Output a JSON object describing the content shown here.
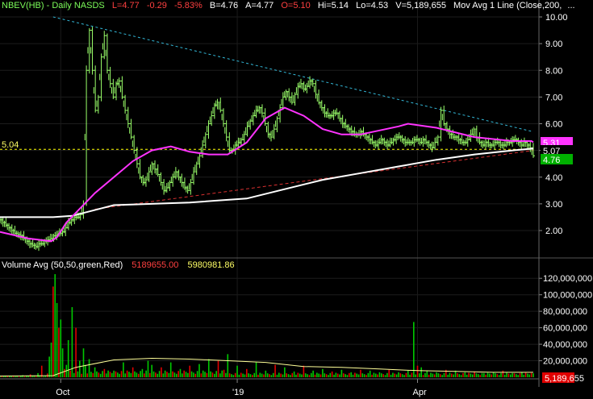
{
  "header": {
    "symbol": "NBEV(HB) - Daily  NASDS",
    "last": "L=4.77",
    "change": "-0.29",
    "change_pct": "-5.83%",
    "bid": "B=4.76",
    "ask": "A=4.77",
    "open": "O=5.10",
    "high": "Hi=5.14",
    "low": "Lo=4.53",
    "volume": "V=5,189,655",
    "study": "Mov Avg 1 Line (Close,200,",
    "more": "..."
  },
  "volume_header": {
    "label": "Volume Avg (50,50,green,Red)",
    "value1": "5189655.00",
    "value2": "5980981.86"
  },
  "price_axis": {
    "ticks": [
      "10.00",
      "9.00",
      "8.00",
      "7.00",
      "6.00",
      "5.00",
      "4.00",
      "3.00",
      "2.00"
    ],
    "tick_values": [
      10,
      9,
      8,
      7,
      6,
      5,
      4,
      3,
      2
    ],
    "ylim": [
      1.0,
      10.3
    ]
  },
  "volume_axis": {
    "ticks": [
      "120,000,000",
      "100,000,000",
      "80,000,000",
      "60,000,000",
      "40,000,000",
      "20,000,000"
    ],
    "tick_values": [
      120000000,
      100000000,
      80000000,
      60000000,
      40000000,
      20000000
    ],
    "ylim": [
      0,
      130000000
    ]
  },
  "x_axis": {
    "labels": [
      "Oct",
      "'19",
      "Apr"
    ],
    "label_index": [
      32,
      125,
      220
    ]
  },
  "value_tags": {
    "mavg": "5.31",
    "sma200": "5.07",
    "last": "4.76",
    "hline_label": "5.04",
    "volume_last": "5,189,655"
  },
  "colors": {
    "background": "#000000",
    "up": "#00c800",
    "down": "#e00000",
    "price": "#9aff6a",
    "mavg": "#ff33ff",
    "sma200": "#ffffff",
    "volume_avg": "#ffff99",
    "resistance": "#33b8d8",
    "support": "#d83030",
    "hline": "#ffff00"
  },
  "chart_data": {
    "type": "line",
    "series": [
      {
        "key": "close",
        "values": [
          2.4,
          2.3,
          2.2,
          2.1,
          2.0,
          1.9,
          1.85,
          1.8,
          1.7,
          1.6,
          1.5,
          1.45,
          1.4,
          1.5,
          1.5,
          1.6,
          1.65,
          1.7,
          1.8,
          1.85,
          1.9,
          1.95,
          2.1,
          2.3,
          2.4,
          2.5,
          2.5,
          2.6,
          3.0,
          8.0,
          9.5,
          8.0,
          6.5,
          7.0,
          8.5,
          9.3,
          8.0,
          7.5,
          7.0,
          7.5,
          7.6,
          7.0,
          6.5,
          6.0,
          5.5,
          5.0,
          4.5,
          4.0,
          3.8,
          3.9,
          4.2,
          4.5,
          4.3,
          4.1,
          3.8,
          3.5,
          3.6,
          3.8,
          4.0,
          4.2,
          4.0,
          3.8,
          3.6,
          3.5,
          3.8,
          4.2,
          4.5,
          4.8,
          5.2,
          5.6,
          6.0,
          6.3,
          6.7,
          6.8,
          6.5,
          6.0,
          5.5,
          5.0,
          5.0,
          5.2,
          5.3,
          5.4,
          5.6,
          5.9,
          6.1,
          6.3,
          6.5,
          6.6,
          6.4,
          6.0,
          5.6,
          5.5,
          5.8,
          6.2,
          6.6,
          7.0,
          7.2,
          7.0,
          6.8,
          7.1,
          7.4,
          7.5,
          7.3,
          7.4,
          7.6,
          7.5,
          7.1,
          6.8,
          6.6,
          6.4,
          6.3,
          6.3,
          6.4,
          6.4,
          6.2,
          6.0,
          5.9,
          5.8,
          5.7,
          5.6,
          5.6,
          5.7,
          5.6,
          5.5,
          5.4,
          5.3,
          5.2,
          5.3,
          5.4,
          5.3,
          5.2,
          5.3,
          5.4,
          5.5,
          5.5,
          5.4,
          5.3,
          5.3,
          5.3,
          5.4,
          5.4,
          5.3,
          5.4,
          5.3,
          5.2,
          5.1,
          5.3,
          5.5,
          6.5,
          6.0,
          5.8,
          5.6,
          5.5,
          5.5,
          5.4,
          5.3,
          5.3,
          5.4,
          5.6,
          5.8,
          5.5,
          5.3,
          5.2,
          5.3,
          5.2,
          5.2,
          5.3,
          5.3,
          5.2,
          5.2,
          5.3,
          5.3,
          5.4,
          5.4,
          5.3,
          5.2,
          5.3,
          5.2,
          5.1,
          4.8
        ],
        "values_are_x_index_from_0": true
      },
      {
        "key": "mavg",
        "name": "Mov Avg 1 Line",
        "x": [
          0,
          15,
          27,
          30,
          35,
          50,
          70,
          80,
          90,
          100,
          110,
          120,
          130,
          140,
          150,
          160,
          170,
          180,
          190,
          210,
          215,
          230,
          250,
          270,
          280,
          281
        ],
        "values": [
          1.95,
          1.7,
          1.6,
          1.75,
          2.3,
          3.4,
          4.6,
          5.0,
          5.15,
          4.95,
          4.85,
          4.85,
          5.3,
          6.2,
          6.6,
          6.3,
          5.8,
          5.6,
          5.6,
          5.9,
          6.0,
          5.85,
          5.5,
          5.35,
          5.35,
          5.31
        ]
      },
      {
        "key": "sma200",
        "x": [
          0,
          28,
          38,
          60,
          80,
          100,
          130,
          150,
          170,
          190,
          210,
          230,
          250,
          270,
          281
        ],
        "values": [
          2.5,
          2.5,
          2.55,
          2.95,
          3.0,
          3.05,
          3.2,
          3.55,
          3.9,
          4.15,
          4.4,
          4.65,
          4.85,
          5.0,
          5.07
        ]
      },
      {
        "key": "volume_avg",
        "x": [
          0,
          28,
          40,
          60,
          80,
          100,
          120,
          140,
          160,
          180,
          200,
          220,
          240,
          260,
          281
        ],
        "values": [
          1500000,
          2000000,
          12000000,
          21000000,
          23000000,
          22000000,
          20000000,
          18000000,
          13000000,
          12000000,
          10000000,
          8000000,
          7000000,
          6000000,
          5980981.86
        ]
      },
      {
        "key": "resistance",
        "x": [
          28,
          281
        ],
        "values": [
          10.0,
          5.7
        ]
      },
      {
        "key": "support",
        "x": [
          50,
          281
        ],
        "values": [
          2.8,
          5.0
        ]
      },
      {
        "key": "hline",
        "x": [
          0,
          281
        ],
        "values": [
          5.04,
          5.04
        ]
      }
    ],
    "volume_spikes": {
      "x": [
        3,
        5,
        8,
        12,
        16,
        20,
        22,
        25,
        26,
        27,
        28,
        29,
        30,
        31,
        32,
        33,
        34,
        35,
        36,
        38,
        40,
        42,
        44,
        45,
        47,
        50,
        55,
        60,
        65,
        70,
        75,
        78,
        80,
        85,
        90,
        95,
        100,
        105,
        110,
        115,
        118,
        120,
        125,
        130,
        135,
        140,
        145,
        150,
        155,
        160,
        165,
        170,
        175,
        180,
        185,
        190,
        195,
        200,
        205,
        210,
        215,
        218,
        220,
        222,
        225,
        230,
        235,
        240,
        245,
        250,
        255,
        260,
        265,
        270,
        275,
        280
      ],
      "values": [
        2000000,
        1500000,
        1000000,
        2500000,
        3500000,
        5000000,
        14000000,
        4500000,
        25000000,
        42000000,
        110000000,
        125000000,
        90000000,
        60000000,
        70000000,
        35000000,
        10000000,
        15000000,
        45000000,
        85000000,
        60000000,
        20000000,
        35000000,
        15000000,
        22000000,
        12000000,
        10000000,
        8000000,
        18000000,
        12000000,
        10000000,
        20000000,
        15000000,
        12000000,
        18000000,
        10000000,
        14000000,
        16000000,
        22000000,
        20000000,
        9000000,
        28000000,
        14000000,
        10000000,
        18000000,
        8000000,
        15000000,
        12000000,
        7000000,
        14000000,
        8000000,
        10000000,
        7000000,
        9000000,
        6000000,
        9000000,
        8000000,
        6000000,
        9000000,
        6000000,
        8000000,
        67000000,
        14000000,
        12000000,
        8000000,
        6000000,
        9000000,
        8000000,
        6000000,
        7000000,
        5000000,
        6000000,
        8000000,
        5000000,
        6000000,
        5189655
      ]
    }
  }
}
